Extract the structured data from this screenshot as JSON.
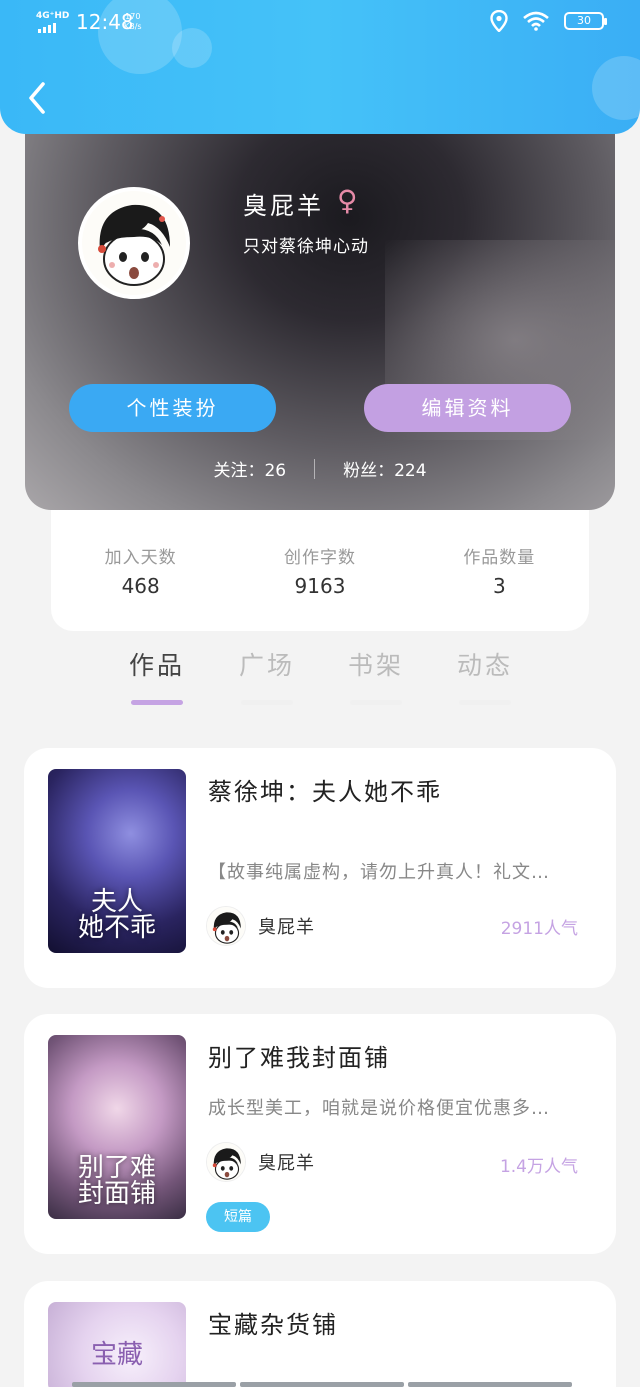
{
  "status_bar": {
    "network": "4G⁺HD",
    "time": "12:48",
    "speed_value": "170",
    "speed_unit": "KB/s",
    "battery": "30"
  },
  "profile": {
    "name": "臭屁羊",
    "gender_symbol": "♀",
    "bio": "只对蔡徐坤心动",
    "dress_button": "个性装扮",
    "edit_button": "编辑资料",
    "following_label": "关注：",
    "following_count": "26",
    "fans_label": "粉丝：",
    "fans_count": "224"
  },
  "stats": [
    {
      "label": "加入天数",
      "value": "468"
    },
    {
      "label": "创作字数",
      "value": "9163"
    },
    {
      "label": "作品数量",
      "value": "3"
    }
  ],
  "tabs": [
    {
      "label": "作品",
      "active": true
    },
    {
      "label": "广场",
      "active": false
    },
    {
      "label": "书架",
      "active": false
    },
    {
      "label": "动态",
      "active": false
    }
  ],
  "works": [
    {
      "title": "蔡徐坤：夫人她不乖",
      "cover_text_line1": "夫人",
      "cover_text_line2": "她不乖",
      "description": "【故事纯属虚构，请勿上升真人！礼文…",
      "author": "臭屁羊",
      "popularity": "2911人气"
    },
    {
      "title": "别了难我封面铺",
      "cover_text_line1": "别了难",
      "cover_text_line2": "封面铺",
      "description": "成长型美工，咱就是说价格便宜优惠多…",
      "author": "臭屁羊",
      "popularity": "1.4万人气",
      "tag": "短篇"
    },
    {
      "title": "宝藏杂货铺",
      "cover_text_line1": "宝藏"
    }
  ],
  "colors": {
    "header_blue": "#45c2f8",
    "accent_purple": "#c5a3e3",
    "button_blue": "#3aa9f3",
    "tag_blue": "#4cc4f2",
    "gender_pink": "#e68aa7"
  }
}
